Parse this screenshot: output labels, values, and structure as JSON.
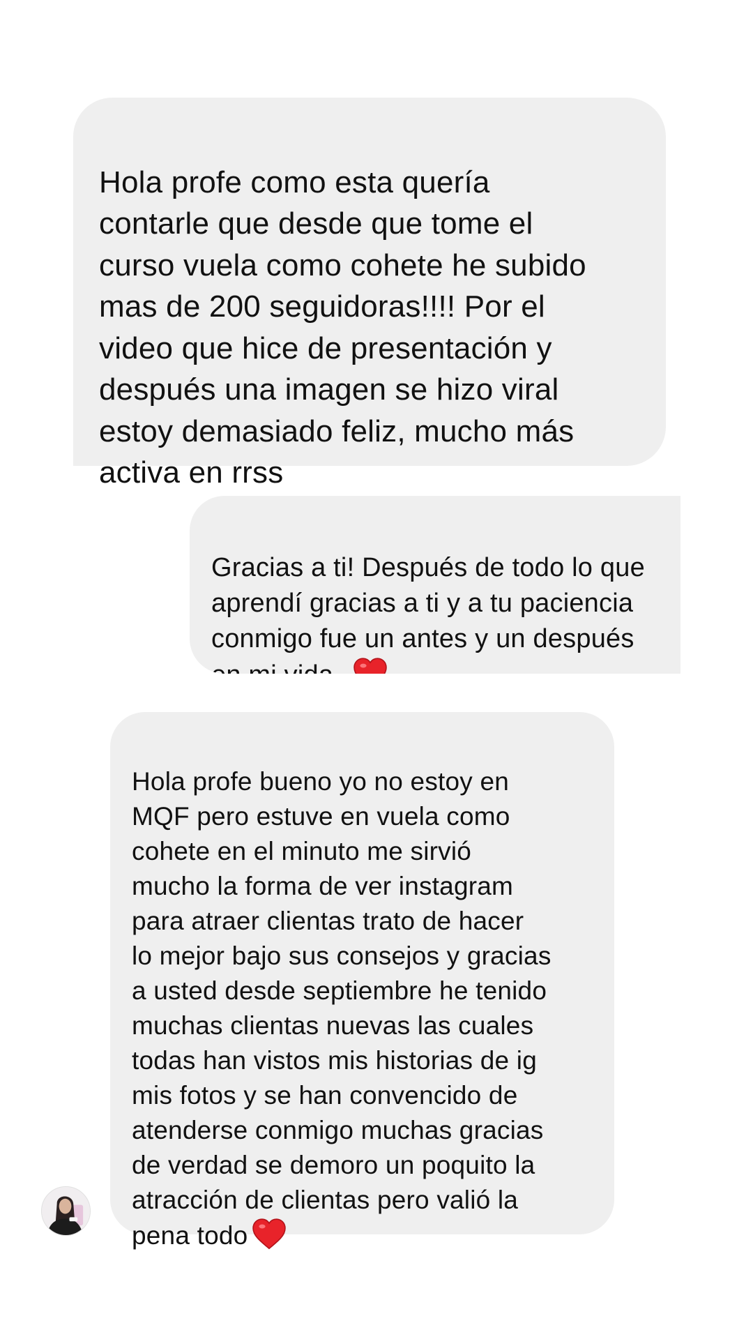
{
  "conversation": {
    "messages": [
      {
        "text": "Hola profe como esta quería\ncontarle que desde que tome el\ncurso vuela como cohete he subido\nmas de 200 seguidoras!!!! Por el\nvideo que hice de presentación y\ndespués una imagen se hizo viral\nestoy demasiado feliz, mucho más\nactiva en rrss"
      },
      {
        "text": "Gracias a ti! Después de todo lo que\naprendí gracias a ti y a tu paciencia\nconmigo fue un antes y un después\nen mi vida..",
        "emoji": "heart-icon"
      },
      {
        "text": "Hola profe bueno yo no estoy en\nMQF pero estuve en vuela como\ncohete en el minuto me sirvió\nmucho la forma de ver instagram\npara atraer clientas trato de hacer\nlo mejor bajo sus consejos y gracias\na usted desde septiembre he tenido\nmuchas clientas nuevas las cuales\ntodas han vistos mis historias de ig\nmis fotos y se han convencido de\natenderse conmigo muchas gracias\nde verdad se demoro un poquito la\natracción de clientas pero valió la\npena todo",
        "emoji": "heart-icon"
      }
    ]
  },
  "colors": {
    "bubble_background": "#efefef",
    "text": "#111111",
    "heart": "#e8232a",
    "page_background": "#ffffff"
  }
}
